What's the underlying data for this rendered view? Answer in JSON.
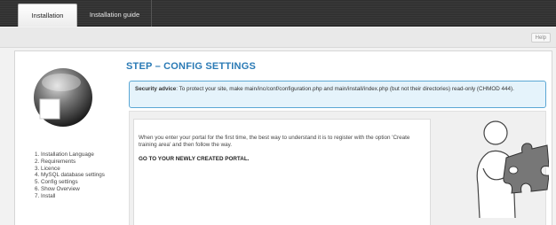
{
  "tabs": [
    {
      "label": "Installation",
      "active": true
    },
    {
      "label": "Installation guide",
      "active": false
    }
  ],
  "help": {
    "label": "Help"
  },
  "steps": [
    "1. Installation Language",
    "2. Requirements",
    "3. Licence",
    "4. MySQL database settings",
    "5. Config settings",
    "6. Show Overview",
    "7. Install"
  ],
  "main": {
    "title": "STEP – CONFIG SETTINGS",
    "advice": {
      "label": "Security advice",
      "text": ": To protect your site, make main/inc/conf/configuration.php and main/install/index.php (but not their directories) read-only (CHMOD 444)."
    },
    "info": {
      "text": "When you enter your portal for the first time, the best way to understand it is to register with the option 'Create training area' and then follow the way.",
      "link": "GO TO YOUR NEWLY CREATED PORTAL."
    }
  },
  "colors": {
    "title": "#2a7ab5",
    "advice_border": "#5ba7d4",
    "advice_bg": "#e5f3fb"
  },
  "icons": {
    "logo": "chamilo-logo-icon",
    "illustration": "person-puzzle-icon"
  }
}
